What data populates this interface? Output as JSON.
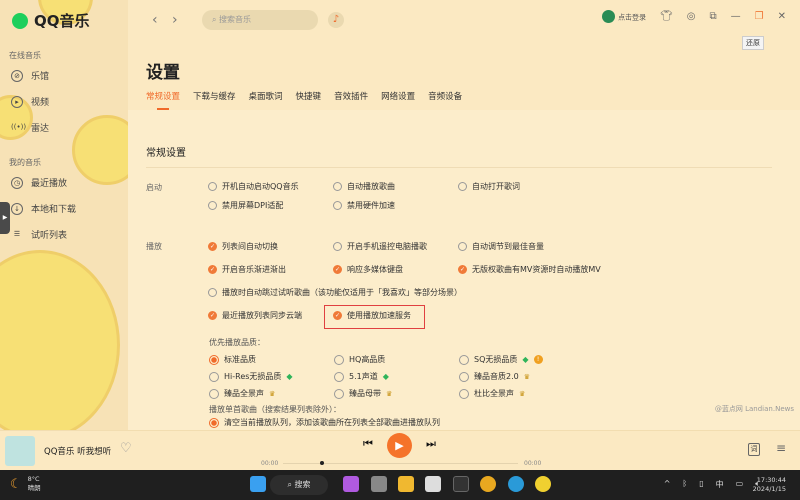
{
  "app": {
    "name": "QQ音乐"
  },
  "sidebar": {
    "groups": [
      {
        "label": "在线音乐",
        "items": [
          {
            "label": "乐馆",
            "icon": "compass-icon"
          },
          {
            "label": "视频",
            "icon": "video-icon"
          },
          {
            "label": "雷达",
            "icon": "radar-icon"
          }
        ]
      },
      {
        "label": "我的音乐",
        "items": [
          {
            "label": "最近播放",
            "icon": "clock-icon"
          },
          {
            "label": "本地和下载",
            "icon": "download-icon"
          },
          {
            "label": "试听列表",
            "icon": "playlist-icon"
          }
        ]
      }
    ]
  },
  "topbar": {
    "search_placeholder": "搜索音乐",
    "login": "点击登录",
    "tooltip": "还原"
  },
  "page": {
    "title": "设置",
    "tabs": [
      "常规设置",
      "下载与缓存",
      "桌面歌词",
      "快捷键",
      "音效插件",
      "网络设置",
      "音频设备"
    ],
    "active_tab": 0,
    "section": "常规设置"
  },
  "startup": {
    "label": "启动",
    "options": [
      {
        "text": "开机自动启动QQ音乐",
        "checked": false
      },
      {
        "text": "自动播放歌曲",
        "checked": false
      },
      {
        "text": "自动打开歌词",
        "checked": false
      },
      {
        "text": "禁用屏幕DPI适配",
        "checked": false
      },
      {
        "text": "禁用硬件加速",
        "checked": false
      }
    ]
  },
  "playback": {
    "label": "播放",
    "options": [
      {
        "text": "列表间自动切换",
        "checked": true
      },
      {
        "text": "开启手机遥控电脑播歌",
        "checked": false
      },
      {
        "text": "自动调节到最佳音量",
        "checked": false
      },
      {
        "text": "开启音乐渐进渐出",
        "checked": true
      },
      {
        "text": "响应多媒体键盘",
        "checked": true
      },
      {
        "text": "无版权歌曲有MV资源时自动播放MV",
        "checked": true
      },
      {
        "text": "播放时自动跳过试听歌曲（该功能仅适用于「我喜欢」等部分场景）",
        "checked": false
      },
      {
        "text": "最近播放列表同步云端",
        "checked": true
      },
      {
        "text": "使用播放加速服务",
        "checked": true
      }
    ]
  },
  "quality": {
    "label": "优先播放品质：",
    "options": [
      {
        "text": "标准品质",
        "selected": true,
        "badge": ""
      },
      {
        "text": "HQ高品质",
        "selected": false,
        "badge": ""
      },
      {
        "text": "SQ无损品质",
        "selected": false,
        "badge": "gem-icon",
        "info": true
      },
      {
        "text": "Hi-Res无损品质",
        "selected": false,
        "badge": "gem-icon"
      },
      {
        "text": "5.1声道",
        "selected": false,
        "badge": "gem-icon"
      },
      {
        "text": "臻品音质2.0",
        "selected": false,
        "badge": "crown-icon"
      },
      {
        "text": "臻品全景声",
        "selected": false,
        "badge": "crown-icon"
      },
      {
        "text": "臻品母带",
        "selected": false,
        "badge": "crown-icon"
      },
      {
        "text": "杜比全景声",
        "selected": false,
        "badge": "crown-icon"
      }
    ]
  },
  "single_song": {
    "label": "播放单首歌曲（搜索结果列表除外）：",
    "option": "清空当前播放队列，添加该歌曲所在列表全部歌曲进播放队列"
  },
  "watermark": "@蓝点网 Landian.News",
  "player": {
    "song": "QQ音乐 听我想听",
    "elapsed": "00:00",
    "total": "00:00",
    "progress": 0,
    "lyrics_btn": "词"
  },
  "taskbar": {
    "temp": "8°C",
    "weather": "晴朗",
    "search": "搜索",
    "ime": "中",
    "time": "17:30:44",
    "date": "2024/1/15"
  },
  "colors": {
    "accent": "#f06a2a",
    "highlight_box": "#e04040"
  }
}
